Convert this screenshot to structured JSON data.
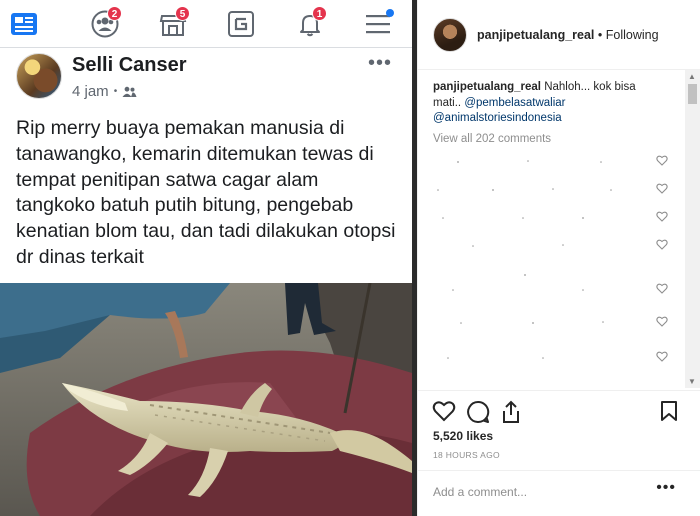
{
  "facebook": {
    "nav": {
      "items": [
        {
          "name": "news-feed",
          "badge": ""
        },
        {
          "name": "friend-requests",
          "badge": "2"
        },
        {
          "name": "marketplace",
          "badge": "5"
        },
        {
          "name": "pages",
          "badge": ""
        },
        {
          "name": "notifications",
          "badge": "1"
        },
        {
          "name": "menu",
          "badge": ""
        }
      ]
    },
    "post": {
      "author": "Selli Canser",
      "time": "4 jam",
      "separator": "•",
      "audience_icon": "friends-icon",
      "more": "•••",
      "text": "Rip merry buaya pemakan manusia di tanawangko, kemarin ditemukan tewas di tempat penitipan satwa cagar alam tangkoko batuh putih bitung, pengebab kenatian blom tau, dan tadi dilakukan otopsi dr dinas terkait"
    }
  },
  "instagram": {
    "username": "panjipetualang_real",
    "follow_sep": "•",
    "follow_status": "Following",
    "caption": {
      "user": "panjipetualang_real",
      "text": " Nahloh... kok bisa mati.. ",
      "mention1": "@pembelasatwaliar",
      "mention2": "@animalstoriesindonesia"
    },
    "view_all": "View all 202 comments",
    "likes": "5,520 likes",
    "time_ago": "18 HOURS AGO",
    "add_comment_placeholder": "Add a comment...",
    "more": "•••",
    "colors": {
      "link": "#00376b",
      "muted": "#8e8e8e",
      "badge": "#e4344d",
      "fb_blue": "#1877f2"
    }
  }
}
